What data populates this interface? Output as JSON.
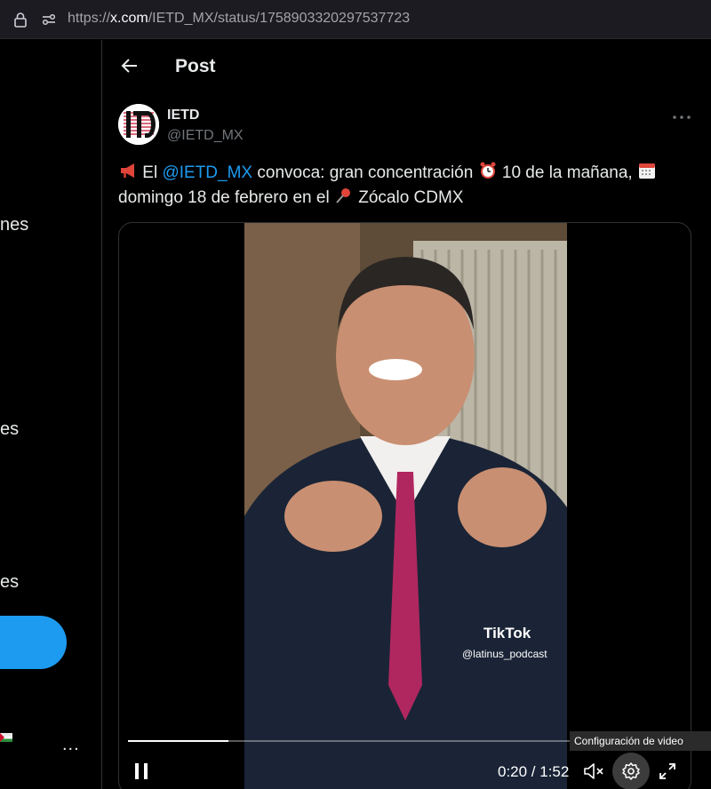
{
  "browser": {
    "url_prefix": "https://",
    "url_host": "x.com",
    "url_path": "/IETD_MX/status/1758903320297537723"
  },
  "sidebar": {
    "fragments": [
      "nes",
      "es",
      "es"
    ],
    "more_label": "..."
  },
  "header": {
    "title": "Post"
  },
  "tweet": {
    "author_name": "IETD",
    "author_handle": "@IETD_MX",
    "text_part1": " El ",
    "mention": "@IETD_MX",
    "text_part2": " convoca: gran concentración ",
    "text_part3": " 10 de la mañana, ",
    "text_part4": "domingo 18 de febrero en el ",
    "text_part5": " Zócalo CDMX",
    "emojis": [
      "megaphone-icon",
      "alarm-clock-icon",
      "calendar-icon",
      "pushpin-icon"
    ]
  },
  "video": {
    "watermark_brand": "TikTok",
    "watermark_handle": "@latinus_podcast",
    "time_display": "0:20 / 1:52",
    "progress_fraction": 0.18,
    "tooltip": "Configuración de video"
  },
  "colors": {
    "accent": "#1d9bf0",
    "background": "#000000",
    "text_primary": "#e7e9ea",
    "text_secondary": "#71767b"
  }
}
